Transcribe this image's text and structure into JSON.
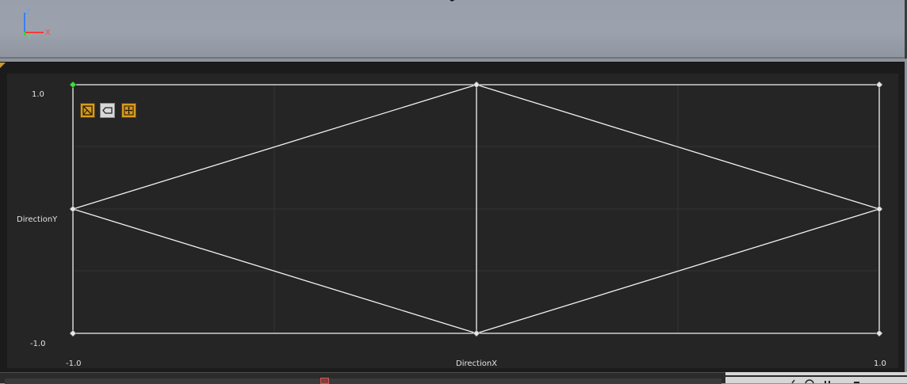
{
  "viewport": {
    "gizmo": {
      "z_label": "Z",
      "x_label": "X",
      "y_label": "Y"
    }
  },
  "graph": {
    "y_axis_label": "DirectionY",
    "y_max_label": "1.0",
    "y_min_label": "-1.0",
    "x_axis_label": "DirectionX",
    "x_min_label": "-1.0",
    "x_max_label": "1.0",
    "selected_sample": "top-left",
    "colors": {
      "background": "#252525",
      "grid": "#333333",
      "lines": "#ffffff",
      "selected_point": "#3fe03f",
      "tool_accent": "#d79b22"
    }
  },
  "toolbar": {
    "icons": [
      "triangulate-icon",
      "bounds-icon",
      "fit-view-icon"
    ]
  }
}
